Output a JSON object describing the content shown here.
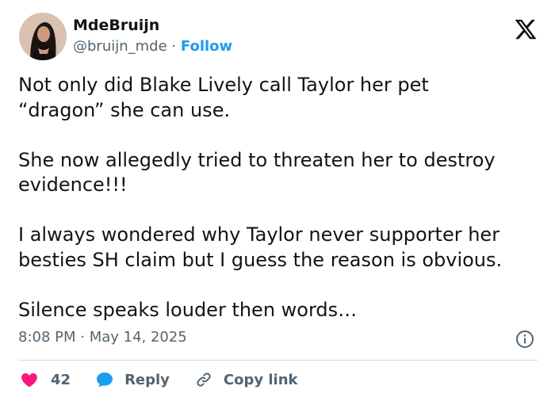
{
  "user": {
    "name": "MdeBruijn",
    "handle": "@bruijn_mde",
    "separator": "·",
    "follow_label": "Follow"
  },
  "tweet": {
    "text": "Not only did Blake Lively call Taylor her pet\n“dragon” she can use.\n\nShe now allegedly tried to threaten her to destroy\nevidence!!!\n\nI always wondered why Taylor never supporter her\nbesties SH claim but I guess the reason is obvious.\n\nSilence speaks louder then words…",
    "timestamp": "8:08 PM · May 14, 2025"
  },
  "actions": {
    "like_count": "42",
    "reply_label": "Reply",
    "copy_link_label": "Copy link"
  },
  "icons": {
    "brand": "x-logo-icon",
    "info": "info-icon",
    "like": "heart-icon",
    "reply": "speech-bubble-icon",
    "copy": "link-icon"
  },
  "colors": {
    "text": "#0f1419",
    "secondary": "#536471",
    "accent": "#1d9bf0",
    "like": "#f91880",
    "divider": "#cfd9de"
  }
}
